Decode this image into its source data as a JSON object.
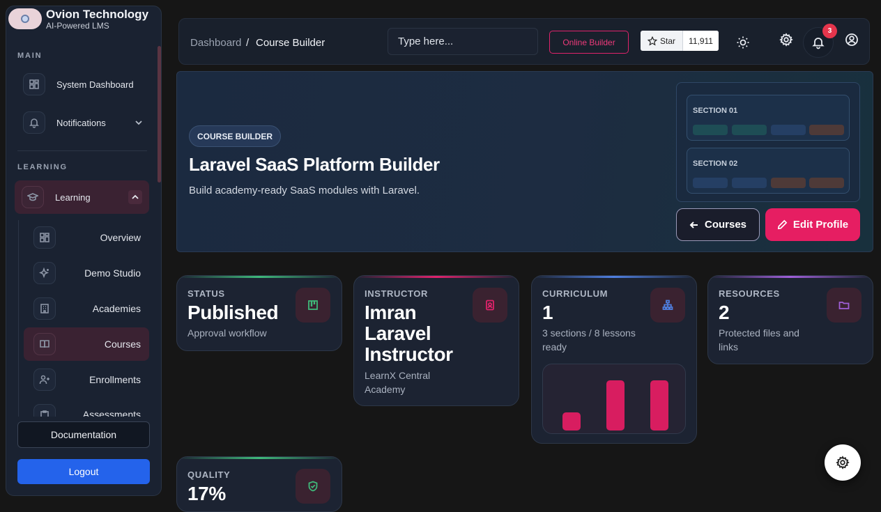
{
  "brand": {
    "name": "Ovion Technology",
    "tagline": "AI-Powered LMS"
  },
  "sidebar": {
    "main_label": "MAIN",
    "learning_label": "LEARNING",
    "main_items": [
      {
        "label": "System Dashboard",
        "icon": "dashboard-icon"
      },
      {
        "label": "Notifications",
        "icon": "bell-icon"
      }
    ],
    "learning_group": {
      "label": "Learning",
      "icon": "graduation-cap-icon",
      "expanded": true
    },
    "sub_items": [
      {
        "label": "Overview",
        "icon": "grid-icon"
      },
      {
        "label": "Demo Studio",
        "icon": "sparkles-icon"
      },
      {
        "label": "Academies",
        "icon": "building-icon"
      },
      {
        "label": "Courses",
        "icon": "book-icon",
        "active": true
      },
      {
        "label": "Enrollments",
        "icon": "user-plus-icon"
      },
      {
        "label": "Assessments",
        "icon": "clipboard-icon"
      }
    ],
    "documentation": "Documentation",
    "logout": "Logout"
  },
  "topbar": {
    "breadcrumb": [
      "Dashboard",
      "Course Builder"
    ],
    "breadcrumb_sep": "/",
    "search_placeholder": "Type here...",
    "online_builder": "Online Builder",
    "star_label": "Star",
    "star_count": "11,911",
    "notification_count": "3"
  },
  "hero": {
    "pill": "COURSE BUILDER",
    "title": "Laravel SaaS Platform Builder",
    "subtitle": "Build academy-ready SaaS modules with Laravel.",
    "preview_sections": [
      "SECTION 01",
      "SECTION 02"
    ],
    "courses_button": "Courses",
    "edit_button": "Edit Profile"
  },
  "cards": [
    {
      "label": "STATUS",
      "value": "Published",
      "desc": "Approval workflow",
      "icon": "kanban-icon",
      "accent": "#3fb97a"
    },
    {
      "label": "INSTRUCTOR",
      "value": "Imran Laravel Instructor",
      "desc": "LearnX Central Academy",
      "icon": "badge-icon",
      "accent": "#e0236b"
    },
    {
      "label": "CURRICULUM",
      "value": "1",
      "desc": "3 sections / 8 lessons ready",
      "icon": "sitemap-icon",
      "accent": "#4f7fe0"
    },
    {
      "label": "RESOURCES",
      "value": "2",
      "desc": "Protected files and links",
      "icon": "folder-icon",
      "accent": "#a05fd8"
    },
    {
      "label": "QUALITY",
      "value": "17%",
      "desc": "",
      "icon": "shield-check-icon",
      "accent": "#3fb97a"
    }
  ],
  "chart_data": {
    "type": "bar",
    "categories": [
      "",
      "",
      ""
    ],
    "values": [
      25,
      70,
      70
    ]
  },
  "colors": {
    "primary": "#e61e62",
    "accent_blue": "#2463eb",
    "bg": "#161616"
  }
}
